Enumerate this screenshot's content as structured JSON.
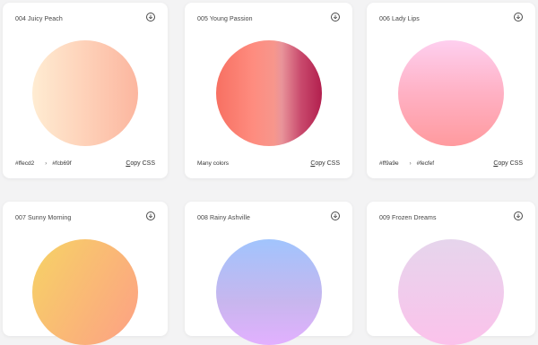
{
  "download_icon": "download-circle-icon",
  "cards": [
    {
      "title": "004 Juicy Peach",
      "from": "#ffecd2",
      "to": "#fcb69f",
      "footer_text": "",
      "copy_label": "Copy CSS",
      "copy_first": "C",
      "copy_rest": "opy CSS"
    },
    {
      "title": "005 Young Passion",
      "from": "",
      "to": "",
      "footer_text": "Many colors",
      "copy_label": "Copy CSS",
      "copy_first": "C",
      "copy_rest": "opy CSS"
    },
    {
      "title": "006 Lady Lips",
      "from": "#ff9a9e",
      "to": "#fecfef",
      "footer_text": "",
      "copy_label": "Copy CSS",
      "copy_first": "C",
      "copy_rest": "opy CSS"
    },
    {
      "title": "007 Sunny Morning"
    },
    {
      "title": "008 Rainy Ashville"
    },
    {
      "title": "009 Frozen Dreams"
    }
  ],
  "colors": {
    "page_background": "#f3f3f4",
    "card_background": "#ffffff"
  }
}
